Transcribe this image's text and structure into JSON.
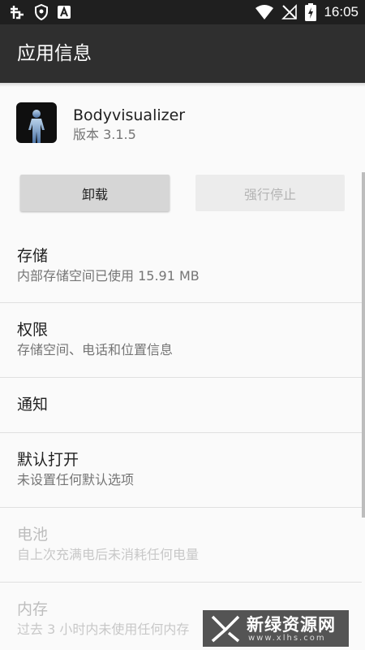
{
  "status_bar": {
    "time": "16:05",
    "left_icons": [
      "bug-icon",
      "shield-icon",
      "app-a-icon"
    ],
    "right_icons": [
      "wifi-icon",
      "no-signal-icon",
      "battery-charging-icon"
    ]
  },
  "app_bar": {
    "title": "应用信息"
  },
  "app": {
    "name": "Bodyvisualizer",
    "version": "版本 3.1.5"
  },
  "buttons": {
    "uninstall": "卸载",
    "force_stop": "强行停止"
  },
  "rows": [
    {
      "title": "存储",
      "subtitle": "内部存储空间已使用 15.91 MB",
      "enabled": true
    },
    {
      "title": "权限",
      "subtitle": "存储空间、电话和位置信息",
      "enabled": true
    },
    {
      "title": "通知",
      "subtitle": "",
      "enabled": true
    },
    {
      "title": "默认打开",
      "subtitle": "未设置任何默认选项",
      "enabled": true
    },
    {
      "title": "电池",
      "subtitle": "自上次充满电后未消耗任何电量",
      "enabled": false
    },
    {
      "title": "内存",
      "subtitle": "过去 3 小时内未使用任何内存",
      "enabled": false
    }
  ],
  "watermark": {
    "text": "新绿资源网",
    "url": "www.xlhs.com"
  },
  "colors": {
    "status_bar": "#1f1f1f",
    "app_bar": "#2f2f2f",
    "background": "#fafafa"
  }
}
